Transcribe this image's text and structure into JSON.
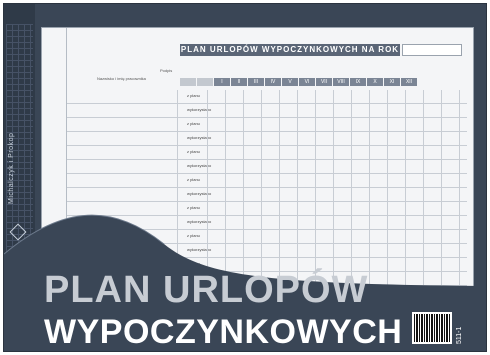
{
  "sheet": {
    "title": "PLAN URLOPÓW WYPOCZYNKOWYCH NA ROK",
    "label_name": "Nazwisko i imię pracownika",
    "label_sign": "Podpis",
    "row_tag_a": "z planu",
    "row_tag_b": "wykorzystano",
    "months": [
      "I",
      "II",
      "III",
      "IV",
      "V",
      "VI",
      "VII",
      "VIII",
      "IX",
      "X",
      "XI",
      "XII"
    ]
  },
  "cover": {
    "title_line1": "PLAN URLOPÓW",
    "title_line2": "WYPOCZYNKOWYCH",
    "spine_text": "Michalczyk i Prokop",
    "code": "511-1"
  }
}
